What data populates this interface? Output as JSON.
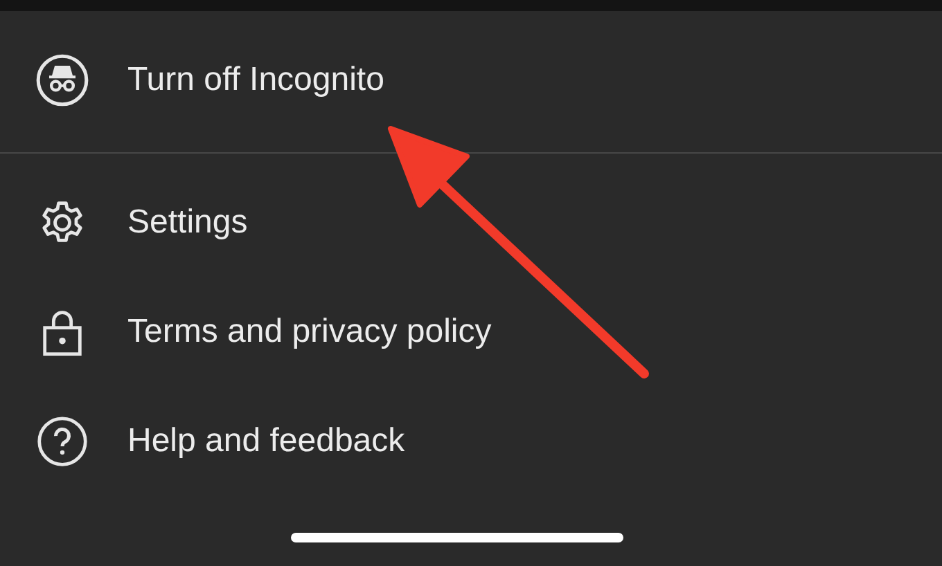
{
  "sections": [
    {
      "items": [
        {
          "label": "Turn off Incognito",
          "kind": "incognito"
        }
      ]
    },
    {
      "items": [
        {
          "label": "Settings",
          "kind": "settings"
        },
        {
          "label": "Terms and privacy policy",
          "kind": "lock"
        },
        {
          "label": "Help and feedback",
          "kind": "help"
        }
      ]
    }
  ]
}
